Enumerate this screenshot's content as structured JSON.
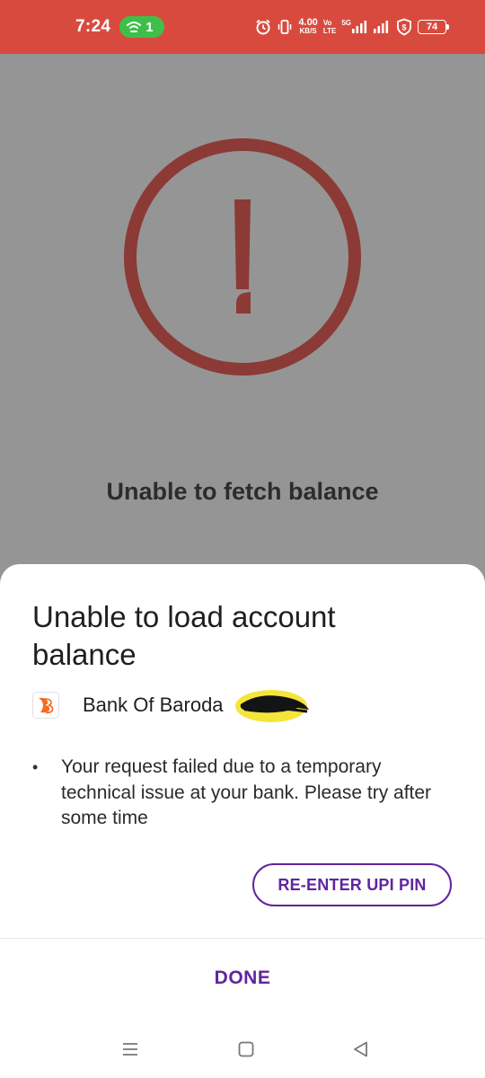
{
  "status_bar": {
    "time": "7:24",
    "hotspot_count": "1",
    "net_speed_value": "4.00",
    "net_speed_unit": "KB/S",
    "volte_top": "Vo",
    "volte_bottom": "LTE",
    "network_type": "5G",
    "battery_level": "74",
    "bar_color": "#d94a3e",
    "icons": [
      "wifi-hotspot-icon",
      "alarm-icon",
      "vibrate-icon",
      "signal-icon",
      "signal-icon",
      "shield-dollar-icon",
      "battery-icon"
    ]
  },
  "backdrop": {
    "title": "Unable to fetch balance",
    "icon": "alert-circle-icon",
    "icon_color": "#8b3a36"
  },
  "sheet": {
    "title": "Unable to load account balance",
    "bank": {
      "name": "Bank Of Baroda",
      "logo_icon": "bank-of-baroda-logo",
      "account_redacted": true
    },
    "message": "Your request failed due to a temporary technical issue at your bank. Please try after some time",
    "reenter_button_label": "RE-ENTER UPI PIN",
    "done_button_label": "DONE",
    "accent_color": "#5f259f"
  },
  "nav_bar": {
    "icons": [
      "menu-icon",
      "home-square-icon",
      "back-triangle-icon"
    ]
  }
}
